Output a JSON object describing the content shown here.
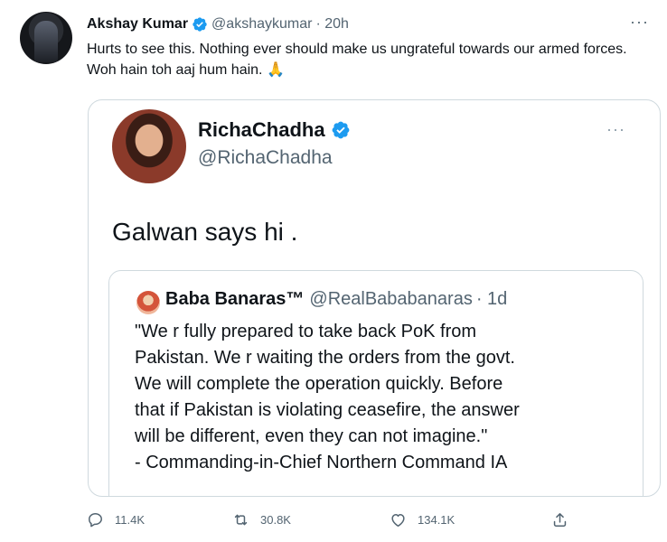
{
  "tweet": {
    "author_name": "Akshay Kumar",
    "handle": "@akshaykumar",
    "time": "· 20h",
    "text": "Hurts to see this. Nothing ever should make us ungrateful towards our armed forces. Woh hain toh aaj hum hain. 🙏",
    "more": "···",
    "stats": {
      "replies": "11.4K",
      "retweets": "30.8K",
      "likes": "134.1K"
    }
  },
  "quoted": {
    "author_name": "RichaChadha",
    "handle": "@RichaChadha",
    "more": "···",
    "text": "Galwan says hi ."
  },
  "inner_quote": {
    "author_name": "Baba Banaras™",
    "handle": "@RealBababanaras",
    "time": "· 1d",
    "lines": [
      "\"We r fully prepared to take back PoK from",
      "Pakistan. We r waiting the orders from the govt.",
      "We will complete the operation quickly. Before",
      "that if Pakistan is violating ceasefire, the answer",
      "will be different, even they can not imagine.\"",
      "- Commanding-in-Chief Northern Command IA"
    ]
  },
  "icons": {
    "verified": "verified-badge-icon",
    "reply": "reply-icon",
    "retweet": "retweet-icon",
    "like": "like-icon",
    "share": "share-icon"
  },
  "colors": {
    "verified": "#1d9bf0",
    "muted": "#536471",
    "text": "#0f1419",
    "border": "#cfd9de"
  }
}
